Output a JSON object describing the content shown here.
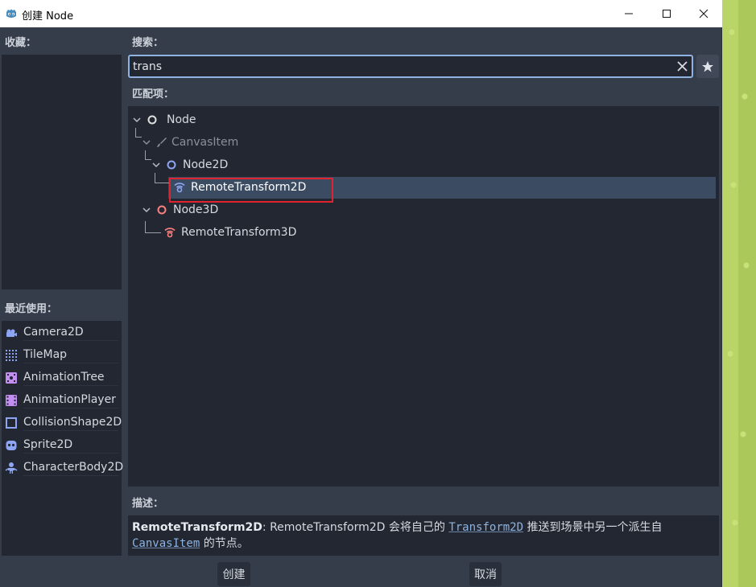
{
  "window": {
    "title": "创建 Node",
    "controls": {
      "minimize": "—",
      "maximize": "☐",
      "close": "✕"
    }
  },
  "sidebar": {
    "favorites_label": "收藏：",
    "recent_label": "最近使用：",
    "recent_items": [
      {
        "label": "Camera2D",
        "icon": "camera-icon",
        "color": "#8da5f3"
      },
      {
        "label": "TileMap",
        "icon": "tilemap-icon",
        "color": "#8da5f3"
      },
      {
        "label": "AnimationTree",
        "icon": "animation-tree-icon",
        "color": "#c38ef1"
      },
      {
        "label": "AnimationPlayer",
        "icon": "animation-player-icon",
        "color": "#c38ef1"
      },
      {
        "label": "CollisionShape2D",
        "icon": "collision-shape-icon",
        "color": "#8da5f3"
      },
      {
        "label": "Sprite2D",
        "icon": "sprite-icon",
        "color": "#8da5f3"
      },
      {
        "label": "CharacterBody2D",
        "icon": "character-body-icon",
        "color": "#8da5f3"
      }
    ]
  },
  "search": {
    "label": "搜索：",
    "value": "trans"
  },
  "matches": {
    "label": "匹配项：",
    "tree": [
      {
        "label": "Node",
        "level": 0,
        "icon": "node-icon",
        "color": "#e0e0e0"
      },
      {
        "label": "CanvasItem",
        "level": 1,
        "icon": "canvas-item-icon",
        "color": "#8a909b",
        "dimmed": true
      },
      {
        "label": "Node2D",
        "level": 2,
        "icon": "node2d-icon",
        "color": "#8da5f3"
      },
      {
        "label": "RemoteTransform2D",
        "level": 3,
        "icon": "remote-transform-2d-icon",
        "color": "#8da5f3",
        "selected": true
      },
      {
        "label": "Node3D",
        "level": 1,
        "icon": "node3d-icon",
        "color": "#fc7f7f"
      },
      {
        "label": "RemoteTransform3D",
        "level": 2,
        "icon": "remote-transform-3d-icon",
        "color": "#fc7f7f"
      }
    ]
  },
  "description": {
    "label": "描述：",
    "name": "RemoteTransform2D",
    "text_1": ": RemoteTransform2D 会将自己的 ",
    "link_1": "Transform2D",
    "text_2": " 推送到场景中另一个派生自",
    "link_2": "CanvasItem",
    "text_3": " 的节点。"
  },
  "buttons": {
    "create": "创建",
    "cancel": "取消"
  },
  "colors": {
    "accent": "#8fb3e0",
    "selection": "#3b4b62",
    "highlight_box": "#e0232e",
    "panel_bg": "#222731",
    "window_bg": "#363d4a"
  }
}
